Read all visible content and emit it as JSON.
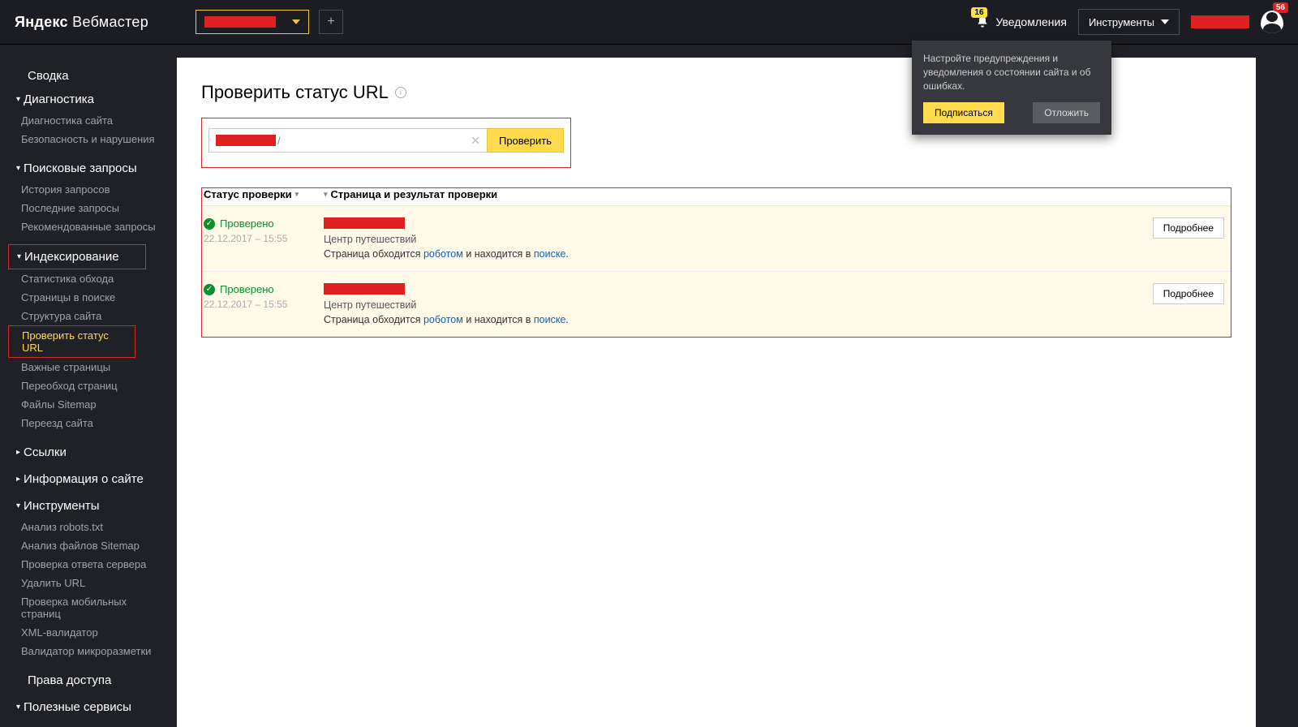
{
  "header": {
    "logo_brand": "Яндекс",
    "logo_product": "Вебмастер",
    "notifications_label": "Уведомления",
    "notifications_count": "16",
    "tools_label": "Инструменты",
    "avatar_badge": "56"
  },
  "popup": {
    "text": "Настройте предупреждения и уведомления о состоянии сайта и об ошибках.",
    "subscribe": "Подписаться",
    "dismiss": "Отложить"
  },
  "sidebar": {
    "summary": "Сводка",
    "diag": "Диагностика",
    "diag_items": [
      "Диагностика сайта",
      "Безопасность и нарушения"
    ],
    "search": "Поисковые запросы",
    "search_items": [
      "История запросов",
      "Последние запросы",
      "Рекомендованные запросы"
    ],
    "indexing": "Индексирование",
    "indexing_items": [
      "Статистика обхода",
      "Страницы в поиске",
      "Структура сайта",
      "Проверить статус URL",
      "Важные страницы",
      "Переобход страниц",
      "Файлы Sitemap",
      "Переезд сайта"
    ],
    "links": "Ссылки",
    "siteinfo": "Информация о сайте",
    "tools": "Инструменты",
    "tools_items": [
      "Анализ robots.txt",
      "Анализ файлов Sitemap",
      "Проверка ответа сервера",
      "Удалить URL",
      "Проверка мобильных страниц",
      "XML-валидатор",
      "Валидатор микроразметки"
    ],
    "access": "Права доступа",
    "services": "Полезные сервисы"
  },
  "main": {
    "title": "Проверить статус URL",
    "url_suffix": "/",
    "check_btn": "Проверить",
    "col_status": "Статус проверки",
    "col_page": "Страница и результат проверки",
    "rows": [
      {
        "status": "Проверено",
        "date": "22.12.2017 – 15:55",
        "desc": "Центр путешествий",
        "t1": "Страница обходится ",
        "l1": "роботом",
        "t2": " и находится в ",
        "l2": "поиске",
        "t3": ".",
        "more": "Подробнее"
      },
      {
        "status": "Проверено",
        "date": "22.12.2017 – 15:55",
        "desc": "Центр путешествий",
        "t1": "Страница обходится ",
        "l1": "роботом",
        "t2": " и находится в ",
        "l2": "поиске",
        "t3": ".",
        "more": "Подробнее"
      }
    ]
  }
}
